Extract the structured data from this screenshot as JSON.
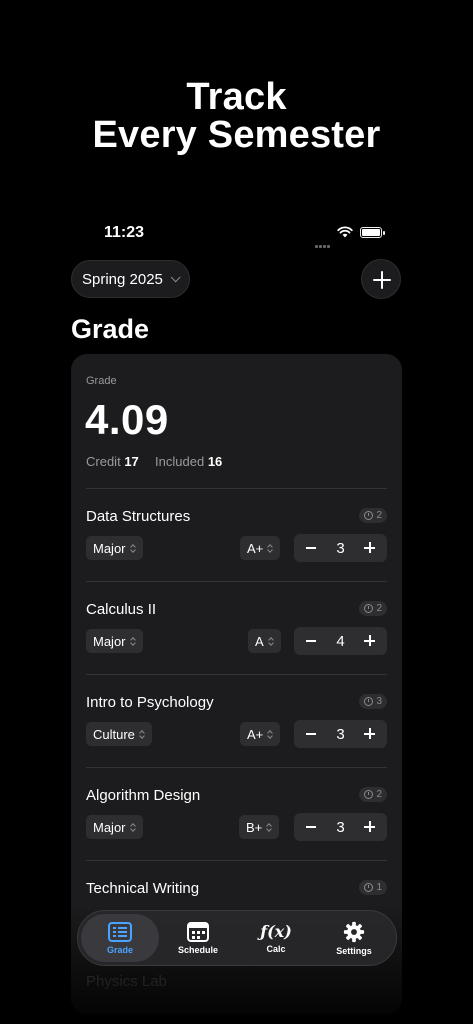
{
  "promo": {
    "line1": "Track",
    "line2": "Every Semester"
  },
  "status": {
    "time": "11:23"
  },
  "header": {
    "semester": "Spring 2025",
    "title": "Grade"
  },
  "summary": {
    "label": "Grade",
    "gpa": "4.09",
    "credit_label": "Credit",
    "credit_value": "17",
    "included_label": "Included",
    "included_value": "16"
  },
  "courses": [
    {
      "name": "Data Structures",
      "badge": "2",
      "type": "Major",
      "grade": "A+",
      "credits": "3"
    },
    {
      "name": "Calculus II",
      "badge": "2",
      "type": "Major",
      "grade": "A",
      "credits": "4"
    },
    {
      "name": "Intro to Psychology",
      "badge": "3",
      "type": "Culture",
      "grade": "A+",
      "credits": "3"
    },
    {
      "name": "Algorithm Design",
      "badge": "2",
      "type": "Major",
      "grade": "B+",
      "credits": "3"
    },
    {
      "name": "Technical Writing",
      "badge": "1",
      "type": "",
      "grade": "",
      "credits": ""
    },
    {
      "name": "Physics Lab",
      "badge": "",
      "type": "",
      "grade": "",
      "credits": ""
    }
  ],
  "tabs": [
    {
      "label": "Grade",
      "icon": "list-icon",
      "active": true
    },
    {
      "label": "Schedule",
      "icon": "calendar-icon",
      "active": false
    },
    {
      "label": "Calc",
      "icon": "function-icon",
      "glyph": "ƒ(x)",
      "active": false
    },
    {
      "label": "Settings",
      "icon": "gear-icon",
      "active": false
    }
  ],
  "colors": {
    "accent": "#4aa3ff",
    "card": "#1c1c1e",
    "background": "#000000"
  }
}
